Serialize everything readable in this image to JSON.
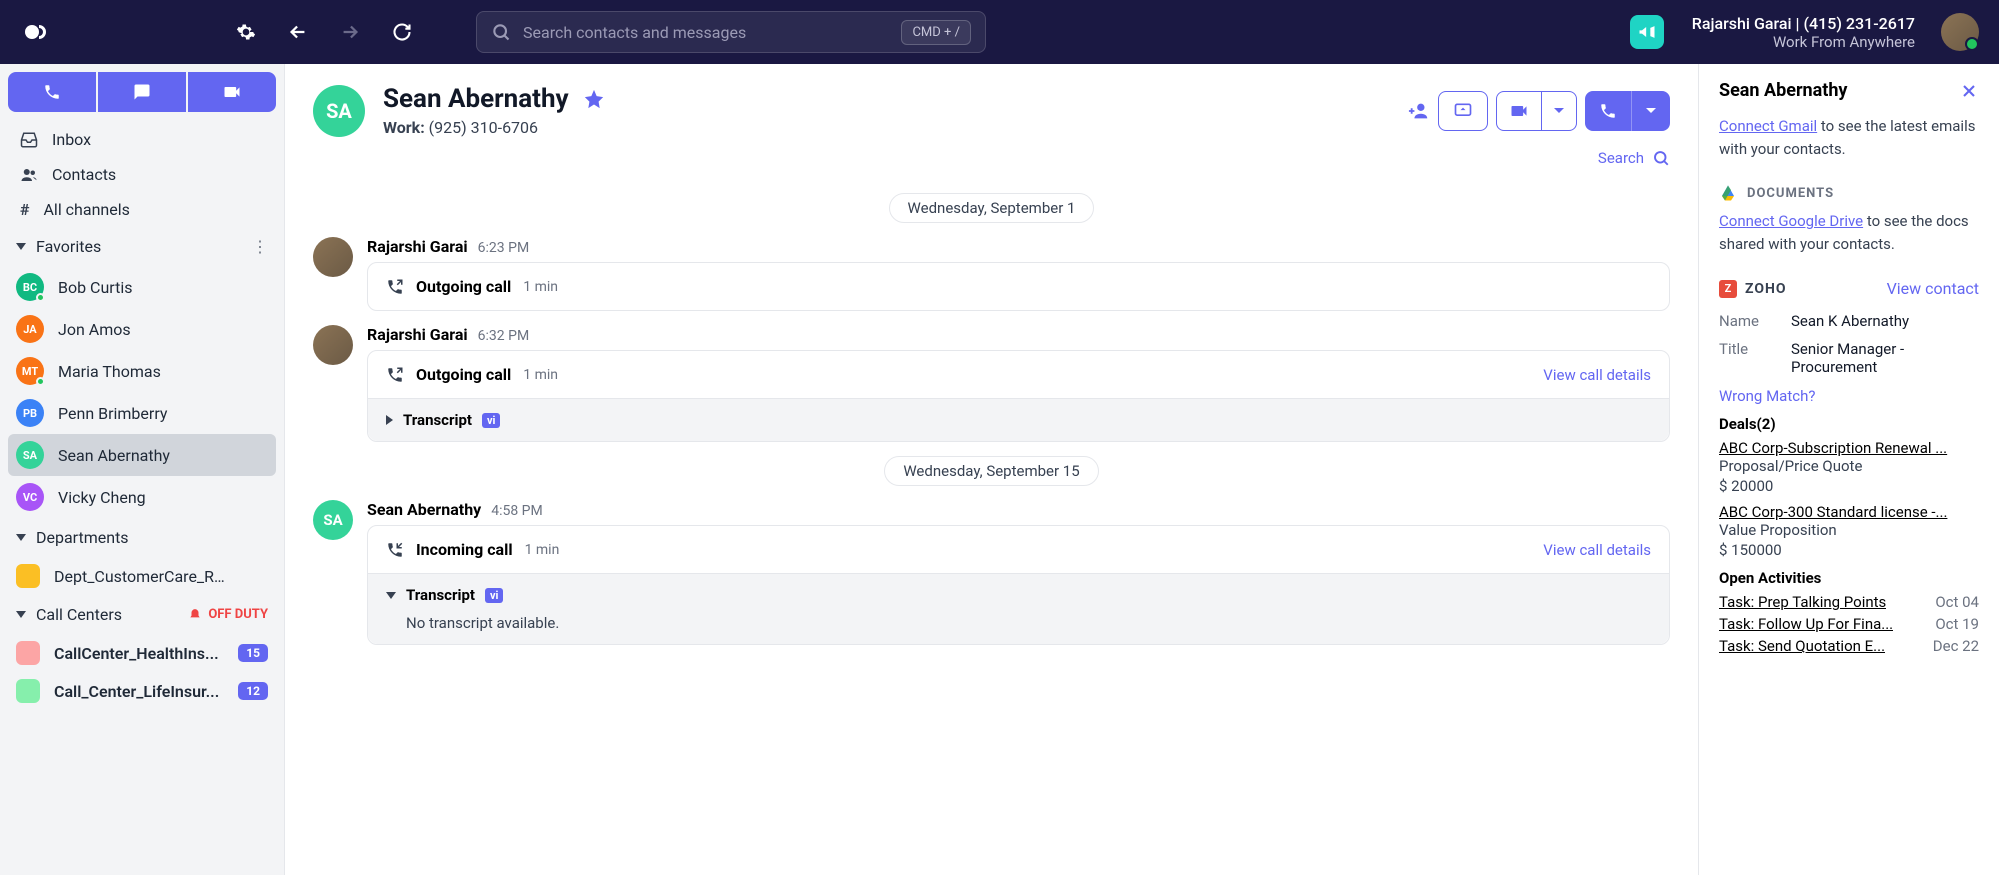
{
  "topbar": {
    "search_placeholder": "Search contacts and messages",
    "cmd_hint": "CMD + /",
    "user_name": "Rajarshi Garai",
    "user_phone": "(415) 231-2617",
    "user_status": "Work From Anywhere"
  },
  "sidebar": {
    "nav": {
      "inbox": "Inbox",
      "contacts": "Contacts",
      "channels": "All channels"
    },
    "favorites_label": "Favorites",
    "favorites": [
      {
        "initials": "BC",
        "name": "Bob Curtis",
        "color": "#10b981",
        "online": true
      },
      {
        "initials": "JA",
        "name": "Jon Amos",
        "color": "#f97316",
        "online": false
      },
      {
        "initials": "MT",
        "name": "Maria Thomas",
        "color": "#f97316",
        "online": true
      },
      {
        "initials": "PB",
        "name": "Penn Brimberry",
        "color": "#3b82f6",
        "online": false
      },
      {
        "initials": "SA",
        "name": "Sean Abernathy",
        "color": "#34d399",
        "online": false,
        "active": true
      },
      {
        "initials": "VC",
        "name": "Vicky Cheng",
        "color": "#a855f7",
        "online": false
      }
    ],
    "departments_label": "Departments",
    "departments": [
      {
        "name": "Dept_CustomerCare_RGC...",
        "color": "#fbbf24"
      }
    ],
    "callcenters_label": "Call Centers",
    "off_duty": "OFF DUTY",
    "callcenters": [
      {
        "name": "CallCenter_HealthIns...",
        "color": "#fca5a5",
        "badge": "15"
      },
      {
        "name": "Call_Center_LifeInsur...",
        "color": "#86efac",
        "badge": "12"
      }
    ]
  },
  "conversation": {
    "contact_name": "Sean Abernathy",
    "contact_initials": "SA",
    "phone_label": "Work:",
    "phone": "(925) 310-6706",
    "search_label": "Search",
    "dates": {
      "d1": "Wednesday, September 1",
      "d2": "Wednesday, September 15"
    },
    "events": [
      {
        "author": "Rajarshi Garai",
        "time": "6:23 PM",
        "type": "Outgoing call",
        "dur": "1 min"
      },
      {
        "author": "Rajarshi Garai",
        "time": "6:32 PM",
        "type": "Outgoing call",
        "dur": "1 min",
        "details": "View call details",
        "transcript_label": "Transcript",
        "vi": "vi"
      },
      {
        "author": "Sean Abernathy",
        "time": "4:58 PM",
        "type": "Incoming call",
        "dur": "1 min",
        "details": "View call details",
        "transcript_label": "Transcript",
        "vi": "vi",
        "transcript_body": "No transcript available."
      }
    ]
  },
  "details": {
    "contact_name": "Sean Abernathy",
    "gmail_link": "Connect Gmail",
    "gmail_text": " to see the latest emails with your contacts.",
    "docs_label": "DOCUMENTS",
    "gdrive_link": "Connect Google Drive",
    "gdrive_text": " to see the docs shared with your contacts.",
    "zoho_label": "ZOHO",
    "view_contact": "View contact",
    "name_label": "Name",
    "name_value": "Sean K Abernathy",
    "title_label": "Title",
    "title_value": "Senior Manager - Procurement",
    "wrong_match": "Wrong Match?",
    "deals_label": "Deals(2)",
    "deals": [
      {
        "name": "ABC Corp-Subscription Renewal ...",
        "stage": "Proposal/Price Quote",
        "amount": "$ 20000"
      },
      {
        "name": "ABC Corp-300 Standard license -...",
        "stage": "Value Proposition",
        "amount": "$ 150000"
      }
    ],
    "activities_label": "Open Activities",
    "activities": [
      {
        "name": "Task: Prep Talking Points",
        "date": "Oct 04"
      },
      {
        "name": "Task: Follow Up For Fina...",
        "date": "Oct 19"
      },
      {
        "name": "Task: Send Quotation E...",
        "date": "Dec 22"
      }
    ]
  }
}
